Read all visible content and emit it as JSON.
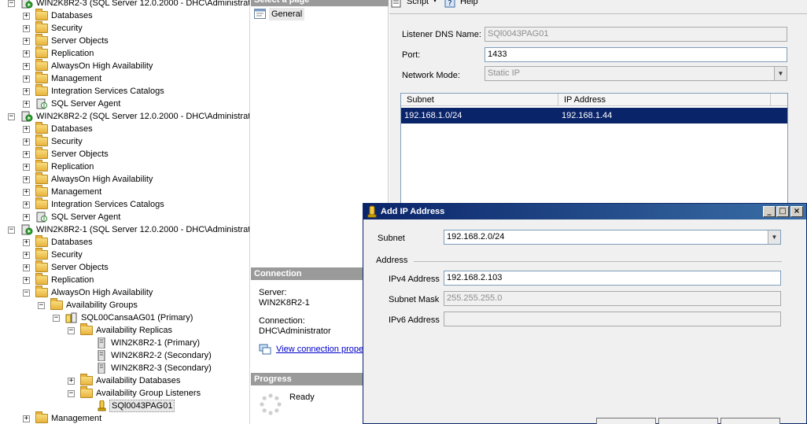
{
  "tree": {
    "rows": [
      {
        "label": "WIN2K8R2-3 (SQL Server 12.0.2000 - DHC\\Administrato",
        "icon": "server-icon",
        "depth": 0,
        "expander": "minus"
      },
      {
        "label": "Databases",
        "icon": "folder-icon",
        "depth": 1,
        "expander": "plus"
      },
      {
        "label": "Security",
        "icon": "folder-icon",
        "depth": 1,
        "expander": "plus"
      },
      {
        "label": "Server Objects",
        "icon": "folder-icon",
        "depth": 1,
        "expander": "plus"
      },
      {
        "label": "Replication",
        "icon": "folder-icon",
        "depth": 1,
        "expander": "plus"
      },
      {
        "label": "AlwaysOn High Availability",
        "icon": "folder-icon",
        "depth": 1,
        "expander": "plus"
      },
      {
        "label": "Management",
        "icon": "folder-icon",
        "depth": 1,
        "expander": "plus"
      },
      {
        "label": "Integration Services Catalogs",
        "icon": "folder-icon",
        "depth": 1,
        "expander": "plus"
      },
      {
        "label": "SQL Server Agent",
        "icon": "agent-icon",
        "depth": 1,
        "expander": "plus"
      },
      {
        "label": "WIN2K8R2-2 (SQL Server 12.0.2000 - DHC\\Administrato",
        "icon": "server-icon",
        "depth": 0,
        "expander": "minus"
      },
      {
        "label": "Databases",
        "icon": "folder-icon",
        "depth": 1,
        "expander": "plus"
      },
      {
        "label": "Security",
        "icon": "folder-icon",
        "depth": 1,
        "expander": "plus"
      },
      {
        "label": "Server Objects",
        "icon": "folder-icon",
        "depth": 1,
        "expander": "plus"
      },
      {
        "label": "Replication",
        "icon": "folder-icon",
        "depth": 1,
        "expander": "plus"
      },
      {
        "label": "AlwaysOn High Availability",
        "icon": "folder-icon",
        "depth": 1,
        "expander": "plus"
      },
      {
        "label": "Management",
        "icon": "folder-icon",
        "depth": 1,
        "expander": "plus"
      },
      {
        "label": "Integration Services Catalogs",
        "icon": "folder-icon",
        "depth": 1,
        "expander": "plus"
      },
      {
        "label": "SQL Server Agent",
        "icon": "agent-icon",
        "depth": 1,
        "expander": "plus"
      },
      {
        "label": "WIN2K8R2-1 (SQL Server 12.0.2000 - DHC\\Administrato",
        "icon": "server-icon",
        "depth": 0,
        "expander": "minus"
      },
      {
        "label": "Databases",
        "icon": "folder-icon",
        "depth": 1,
        "expander": "plus"
      },
      {
        "label": "Security",
        "icon": "folder-icon",
        "depth": 1,
        "expander": "plus"
      },
      {
        "label": "Server Objects",
        "icon": "folder-icon",
        "depth": 1,
        "expander": "plus"
      },
      {
        "label": "Replication",
        "icon": "folder-icon",
        "depth": 1,
        "expander": "plus"
      },
      {
        "label": "AlwaysOn High Availability",
        "icon": "folder-icon",
        "depth": 1,
        "expander": "minus"
      },
      {
        "label": "Availability Groups",
        "icon": "folder-icon",
        "depth": 2,
        "expander": "minus"
      },
      {
        "label": "SQL00CansaAG01 (Primary)",
        "icon": "availability-group-icon",
        "depth": 3,
        "expander": "minus"
      },
      {
        "label": "Availability Replicas",
        "icon": "folder-icon",
        "depth": 4,
        "expander": "minus"
      },
      {
        "label": "WIN2K8R2-1 (Primary)",
        "icon": "replica-icon",
        "depth": 5,
        "expander": "none"
      },
      {
        "label": "WIN2K8R2-2 (Secondary)",
        "icon": "replica-icon",
        "depth": 5,
        "expander": "none"
      },
      {
        "label": "WIN2K8R2-3 (Secondary)",
        "icon": "replica-icon",
        "depth": 5,
        "expander": "none"
      },
      {
        "label": "Availability Databases",
        "icon": "folder-icon",
        "depth": 4,
        "expander": "plus"
      },
      {
        "label": "Availability Group Listeners",
        "icon": "folder-icon",
        "depth": 4,
        "expander": "minus"
      },
      {
        "label": "SQl0043PAG01",
        "icon": "listener-icon",
        "depth": 5,
        "expander": "none",
        "selected": true
      },
      {
        "label": "Management",
        "icon": "folder-icon",
        "depth": 1,
        "expander": "plus"
      }
    ]
  },
  "properties": {
    "select_page_header": "Select a page",
    "pages": [
      {
        "label": "General",
        "icon": "properties-icon"
      }
    ],
    "connection": {
      "header": "Connection",
      "server_label": "Server:",
      "server_value": "WIN2K8R2-1",
      "connection_label": "Connection:",
      "connection_value": "DHC\\Administrator",
      "view_link": "View connection prope"
    },
    "progress": {
      "header": "Progress",
      "status": "Ready"
    },
    "toolbar": {
      "script_label": "Script",
      "help_label": "Help"
    },
    "form": {
      "dns_label": "Listener DNS Name:",
      "dns_value": "SQl0043PAG01",
      "port_label": "Port:",
      "port_value": "1433",
      "network_mode_label": "Network Mode:",
      "network_mode_value": "Static IP"
    },
    "grid": {
      "columns": [
        "Subnet",
        "IP Address"
      ],
      "rows": [
        [
          "192.168.1.0/24",
          "192.168.1.44"
        ]
      ]
    }
  },
  "add_ip": {
    "title": "Add IP Address",
    "subnet_label": "Subnet",
    "subnet_value": "192.168.2.0/24",
    "address_group": "Address",
    "ipv4_label": "IPv4 Address",
    "ipv4_value": "192.168.2.103",
    "mask_label": "Subnet Mask",
    "mask_value": "255.255.255.0",
    "ipv6_label": "IPv6 Address",
    "ipv6_value": ""
  },
  "colors": {
    "selection": "#0a246a",
    "section_header": "#9a9a9a",
    "dialog_title_start": "#0a246a",
    "dialog_title_end": "#3a6ea5"
  }
}
